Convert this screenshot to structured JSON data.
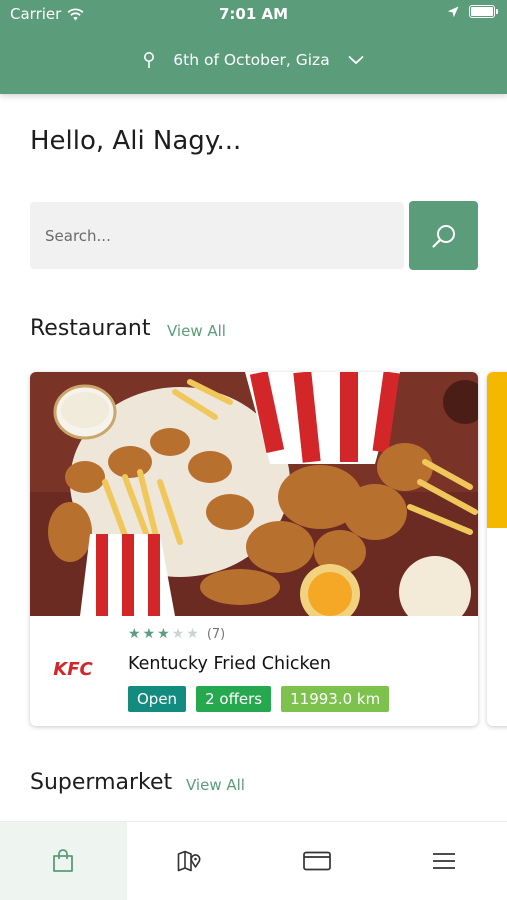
{
  "status_bar": {
    "carrier": "Carrier",
    "time": "7:01 AM"
  },
  "header": {
    "location": "6th of October, Giza"
  },
  "greeting": "Hello, Ali Nagy...",
  "search": {
    "placeholder": "Search...",
    "value": ""
  },
  "sections": {
    "restaurant": {
      "title": "Restaurant",
      "view_all": "View All"
    },
    "supermarket": {
      "title": "Supermarket",
      "view_all": "View All"
    }
  },
  "restaurants": [
    {
      "name": "Kentucky Fried Chicken",
      "logo_text": "KFC",
      "rating": 3,
      "rating_max": 5,
      "review_count": "(7)",
      "status": "Open",
      "offers": "2 offers",
      "distance": "11993.0 km"
    }
  ],
  "bottom_nav": [
    "shopping-bag-icon",
    "map-pin-icon",
    "card-icon",
    "menu-icon"
  ],
  "colors": {
    "primary": "#5b9c7a",
    "open_badge": "#138c7f",
    "offers_badge": "#26a84f",
    "distance_badge": "#7cc24c"
  }
}
